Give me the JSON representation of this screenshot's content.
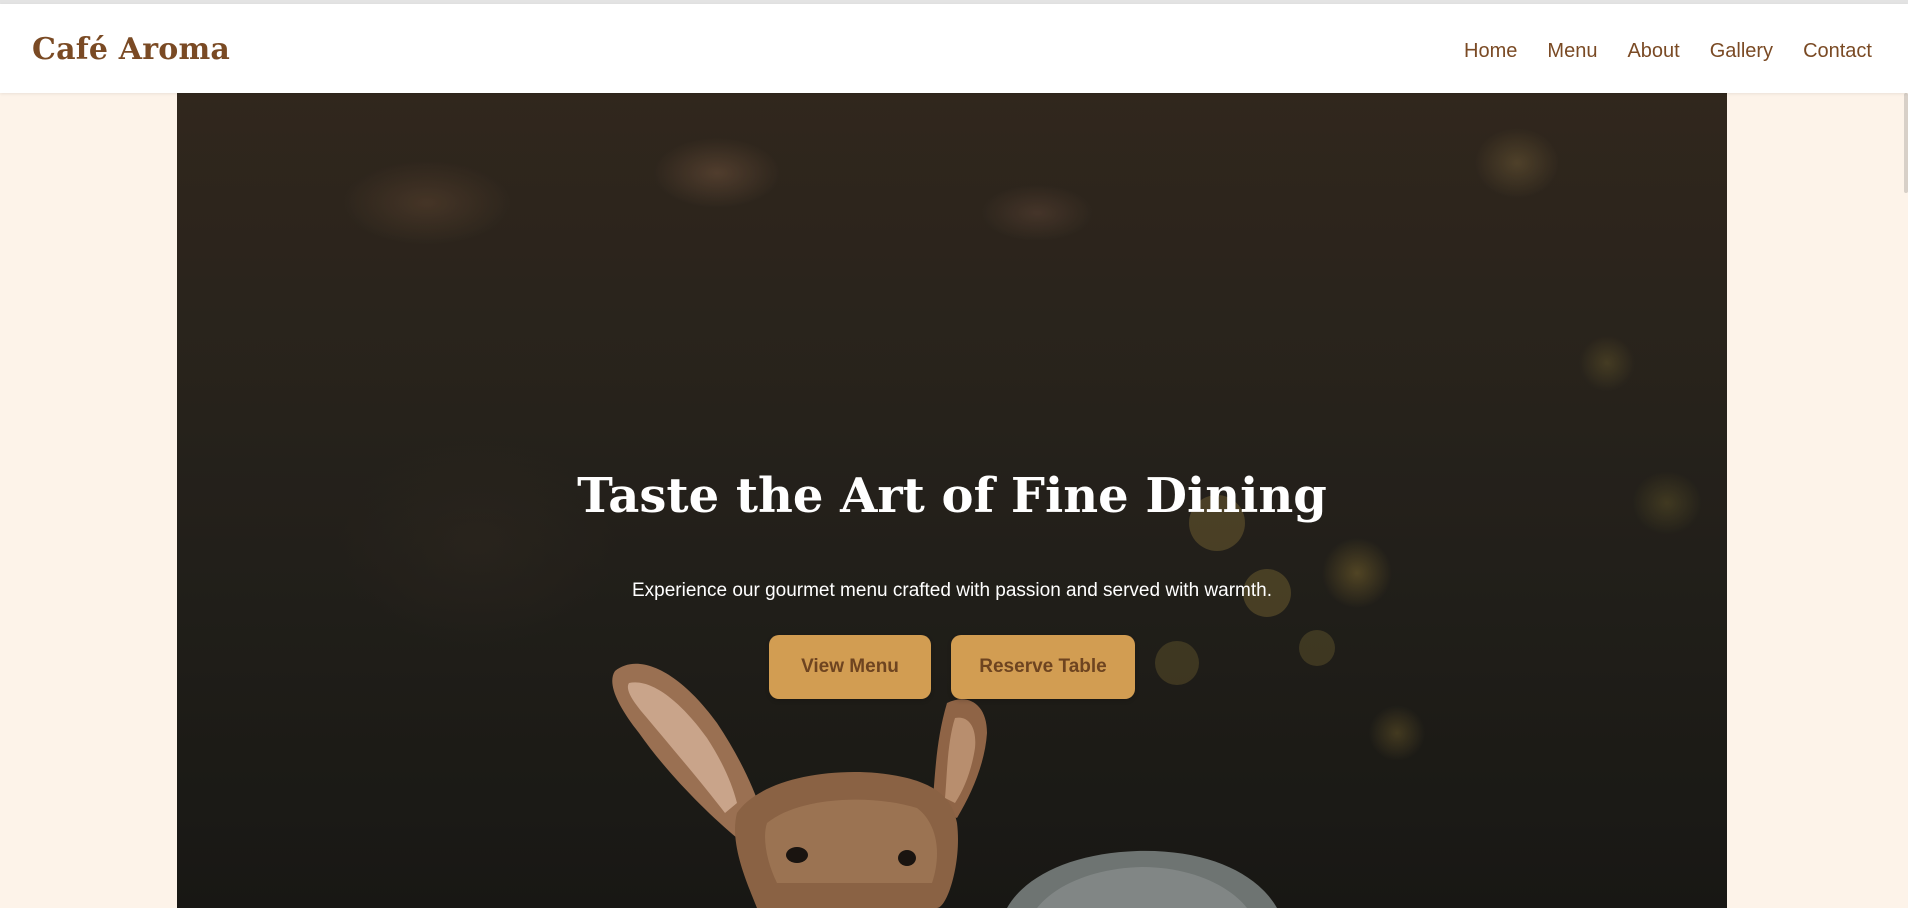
{
  "site": {
    "logo": "Café Aroma"
  },
  "nav": {
    "items": [
      {
        "label": "Home"
      },
      {
        "label": "Menu"
      },
      {
        "label": "About"
      },
      {
        "label": "Gallery"
      },
      {
        "label": "Contact"
      }
    ]
  },
  "hero": {
    "title": "Taste the Art of Fine Dining",
    "subtitle": "Experience our gourmet menu crafted with passion and served with warmth.",
    "primary_button": "View Menu",
    "secondary_button": "Reserve Table",
    "image_subject": "deer"
  },
  "colors": {
    "brand": "#7a4a24",
    "accent": "#d29d52",
    "page_background": "#fdf3e9"
  }
}
